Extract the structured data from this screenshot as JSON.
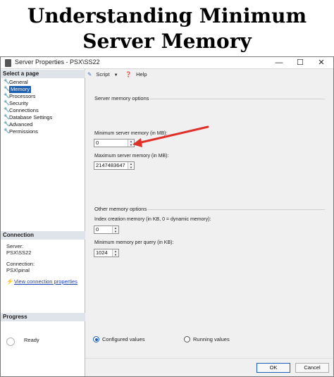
{
  "headline": {
    "line1": "Understanding Minimum",
    "line2": "Server Memory"
  },
  "window": {
    "title": "Server Properties - PSX\\SS22",
    "controls": {
      "minimize": "—",
      "maximize": "☐",
      "close": "✕"
    }
  },
  "left": {
    "select_page_label": "Select a page",
    "pages": [
      {
        "label": "General",
        "selected": false
      },
      {
        "label": "Memory",
        "selected": true
      },
      {
        "label": "Processors",
        "selected": false
      },
      {
        "label": "Security",
        "selected": false
      },
      {
        "label": "Connections",
        "selected": false
      },
      {
        "label": "Database Settings",
        "selected": false
      },
      {
        "label": "Advanced",
        "selected": false
      },
      {
        "label": "Permissions",
        "selected": false
      }
    ],
    "connection": {
      "header": "Connection",
      "server_label": "Server:",
      "server_value": "PSX\\SS22",
      "connection_label": "Connection:",
      "connection_value": "PSX\\pinal",
      "view_link": "View connection properties"
    },
    "progress": {
      "header": "Progress",
      "status": "Ready"
    }
  },
  "toolbar": {
    "script_label": "Script",
    "help_label": "Help",
    "dropdown": "▼"
  },
  "memory": {
    "server_group_title": "Server memory options",
    "min_label": "Minimum server memory (in MB):",
    "min_value": "0",
    "max_label": "Maximum server memory (in MB):",
    "max_value": "2147483647",
    "other_group_title": "Other memory options",
    "index_label": "Index creation memory (in KB, 0 = dynamic memory):",
    "index_value": "0",
    "query_label": "Minimum memory per query (in KB):",
    "query_value": "1024"
  },
  "radios": {
    "configured": "Configured values",
    "running": "Running values",
    "selected": "configured"
  },
  "buttons": {
    "ok": "OK",
    "cancel": "Cancel"
  },
  "colors": {
    "accent": "#1b5fb5",
    "arrow": "#e0302a"
  }
}
